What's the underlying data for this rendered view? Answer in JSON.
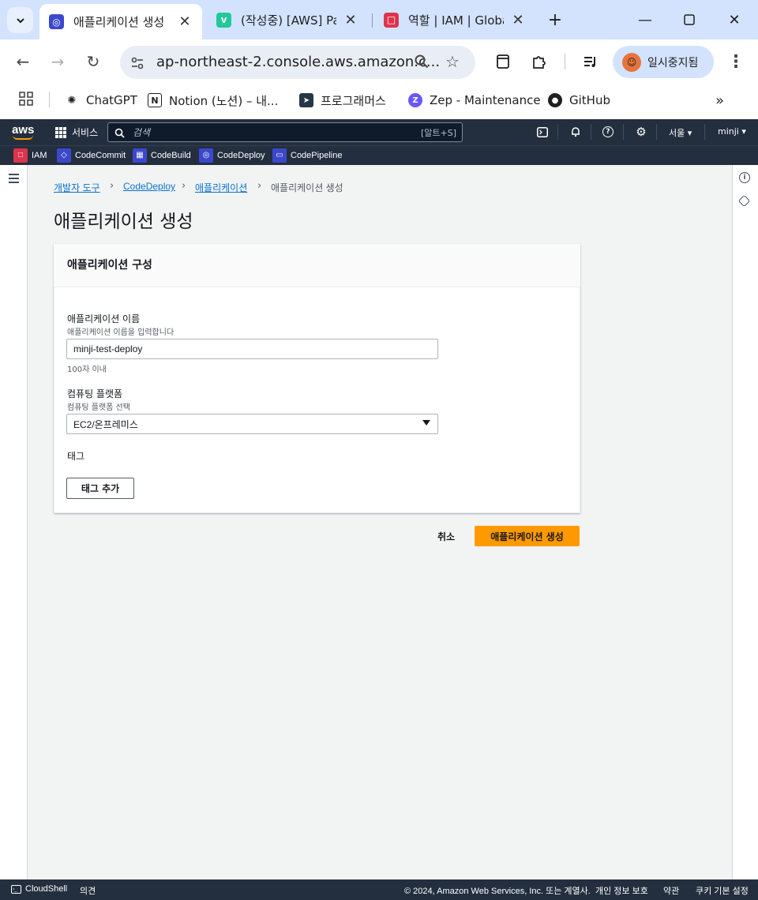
{
  "browser": {
    "tabs": [
      {
        "title": "애플리케이션 생성",
        "icon": "codedeploy-icon",
        "active": true
      },
      {
        "title": "(작성중) [AWS] Pa",
        "icon": "velog-icon",
        "active": false
      },
      {
        "title": "역할 | IAM | Globa",
        "icon": "iam-icon",
        "active": false
      }
    ],
    "url": "ap-northeast-2.console.aws.amazon.c...",
    "profile_label": "일시중지됨",
    "bookmarks": [
      {
        "label": "ChatGPT",
        "icon": "chatgpt-icon"
      },
      {
        "label": "Notion (노션) – 내...",
        "icon": "notion-icon"
      },
      {
        "label": "프로그래머스",
        "icon": "programmers-icon"
      },
      {
        "label": "Zep - Maintenance",
        "icon": "zep-icon"
      },
      {
        "label": "GitHub",
        "icon": "github-icon"
      }
    ],
    "more_glyph": "»"
  },
  "aws_header": {
    "logo": "aws",
    "services_label": "서비스",
    "search_placeholder": "검색",
    "search_shortcut": "[알트+S]",
    "region": "서울 ▾",
    "user": "minji ▾",
    "favorites": [
      {
        "label": "IAM",
        "color": "#dd344c"
      },
      {
        "label": "CodeCommit",
        "color": "#3b48cc"
      },
      {
        "label": "CodeBuild",
        "color": "#3b48cc"
      },
      {
        "label": "CodeDeploy",
        "color": "#3b48cc"
      },
      {
        "label": "CodePipeline",
        "color": "#3b48cc"
      }
    ]
  },
  "breadcrumb": [
    "개발자 도구",
    "CodeDeploy",
    "애플리케이션",
    "애플리케이션 생성"
  ],
  "page_title": "애플리케이션 생성",
  "panel": {
    "title": "애플리케이션 구성",
    "app_name": {
      "label": "애플리케이션 이름",
      "description": "애플리케이션 이름을 입력합니다",
      "value": "minji-test-deploy",
      "constraint": "100자 이내"
    },
    "platform": {
      "label": "컴퓨팅 플랫폼",
      "description": "컴퓨팅 플랫폼 선택",
      "value": "EC2/온프레미스"
    },
    "tags_label": "태그",
    "add_tag_button": "태그 추가"
  },
  "actions": {
    "cancel": "취소",
    "create": "애플리케이션 생성"
  },
  "footer": {
    "cloudshell": "CloudShell",
    "feedback": "의견",
    "copyright": "© 2024, Amazon Web Services, Inc. 또는 계열사.",
    "privacy": "개인 정보 보호",
    "terms": "약관",
    "cookies": "쿠키 기본 설정"
  },
  "colors": {
    "primary_button": "#ff9900",
    "link": "#0972d3",
    "aws_nav": "#232f3e",
    "chrome_frame": "#d3e3fd"
  }
}
